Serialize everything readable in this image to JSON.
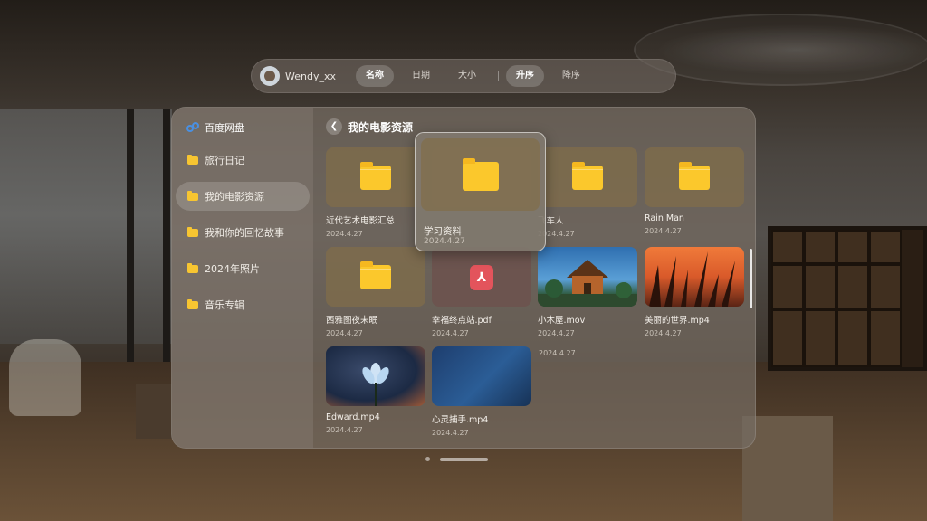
{
  "toolbar": {
    "username": "Wendy_xx",
    "sort_fields": [
      "名称",
      "日期",
      "大小"
    ],
    "active_field": "名称",
    "sort_orders": [
      "升序",
      "降序"
    ],
    "active_order": "升序"
  },
  "sidebar": {
    "app_name": "百度网盘",
    "items": [
      {
        "label": "旅行日记"
      },
      {
        "label": "我的电影资源"
      },
      {
        "label": "我和你的回忆故事"
      },
      {
        "label": "2024年照片"
      },
      {
        "label": "音乐专辑"
      }
    ],
    "active_index": 1
  },
  "content": {
    "title": "我的电影资源",
    "files": [
      {
        "name": "近代艺术电影汇总",
        "date": "2024.4.27",
        "kind": "folder"
      },
      {
        "name": "学习资料",
        "date": "2024.4.27",
        "kind": "folder"
      },
      {
        "name": "飞车人",
        "date": "2024.4.27",
        "kind": "folder"
      },
      {
        "name": "Rain Man",
        "date": "2024.4.27",
        "kind": "folder"
      },
      {
        "name": "西雅图夜未眠",
        "date": "2024.4.27",
        "kind": "folder"
      },
      {
        "name": "幸福终点站.pdf",
        "date": "2024.4.27",
        "kind": "pdf"
      },
      {
        "name": "小木屋.mov",
        "date": "2024.4.27",
        "kind": "video"
      },
      {
        "name": "美丽的世界.mp4",
        "date": "2024.4.27",
        "kind": "video"
      },
      {
        "name": "Edward.mp4",
        "date": "2024.4.27",
        "kind": "video"
      },
      {
        "name": "心灵捕手.mp4",
        "date": "2024.4.27",
        "kind": "video"
      }
    ],
    "extra_date": "2024.4.27"
  },
  "hovered": {
    "name": "学习资料",
    "date": "2024.4.27"
  },
  "colors": {
    "folder": "#fbc82c",
    "pdf": "#e3545c",
    "brand": "#4a90e2"
  }
}
